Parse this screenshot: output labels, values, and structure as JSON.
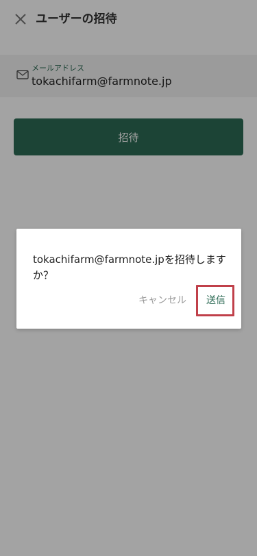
{
  "header": {
    "close_icon": "close-icon",
    "title": "ユーザーの招待"
  },
  "form": {
    "email_label": "メールアドレス",
    "email_value": "tokachifarm@farmnote.jp",
    "mail_icon": "mail-icon",
    "invite_label": "招待"
  },
  "dialog": {
    "message": "tokachifarm@farmnote.jpを招待しますか？",
    "cancel_label": "キャンセル",
    "send_label": "送信"
  },
  "colors": {
    "brand_green": "#2d6b55",
    "highlight_red": "#c0404a",
    "overlay": "rgba(0,0,0,0.36)"
  }
}
